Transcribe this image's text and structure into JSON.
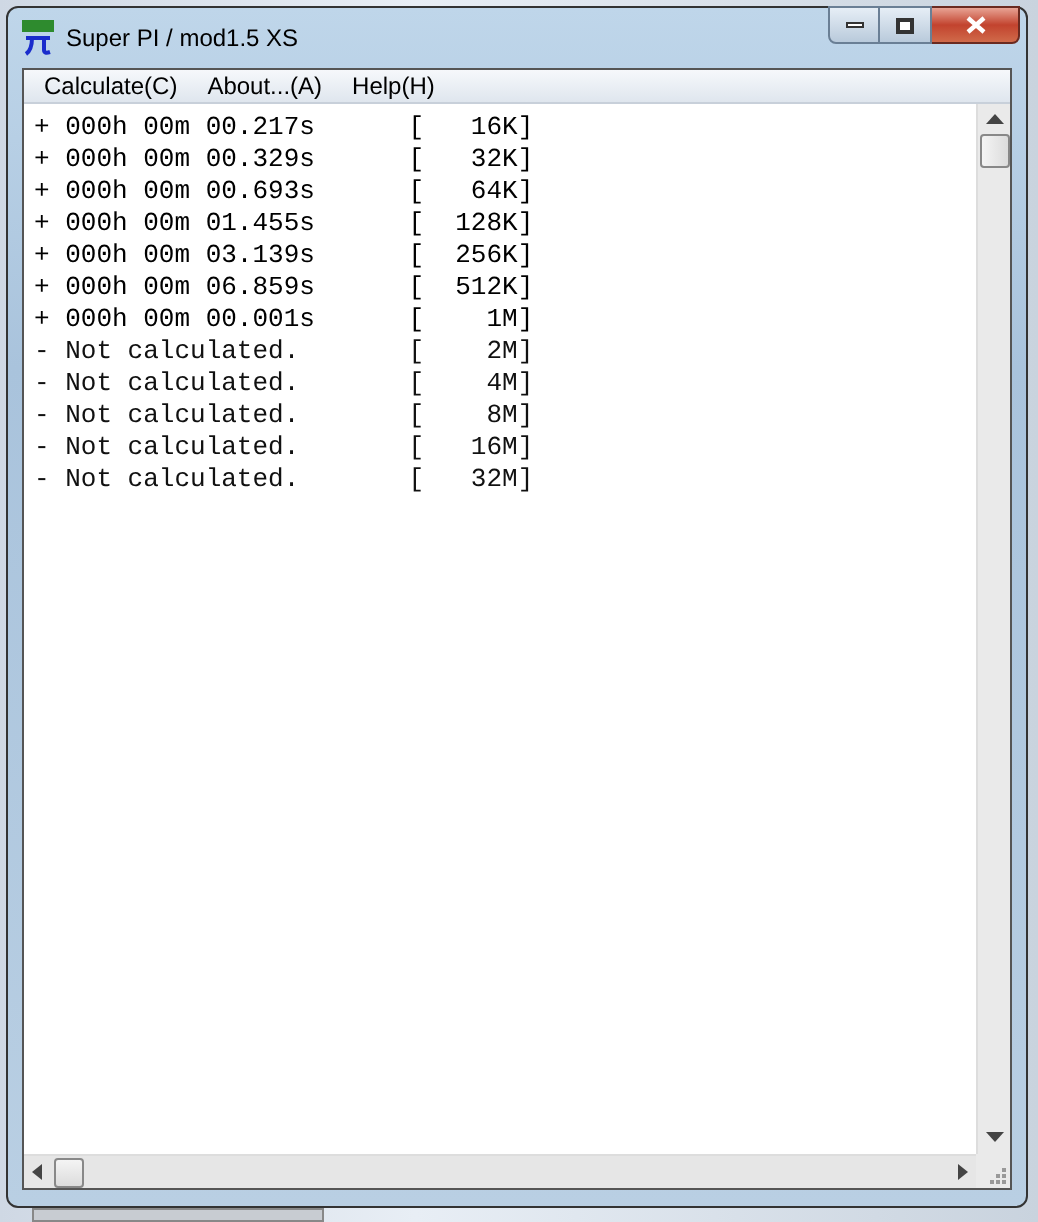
{
  "window": {
    "title": "Super PI / mod1.5 XS"
  },
  "menu": [
    "Calculate(C)",
    "About...(A)",
    "Help(H)"
  ],
  "results": [
    {
      "kind": "done",
      "text": "+ 000h 00m 00.217s      [   16K]"
    },
    {
      "kind": "done",
      "text": "+ 000h 00m 00.329s      [   32K]"
    },
    {
      "kind": "done",
      "text": "+ 000h 00m 00.693s      [   64K]"
    },
    {
      "kind": "done",
      "text": "+ 000h 00m 01.455s      [  128K]"
    },
    {
      "kind": "done",
      "text": "+ 000h 00m 03.139s      [  256K]"
    },
    {
      "kind": "done",
      "text": "+ 000h 00m 06.859s      [  512K]"
    },
    {
      "kind": "done",
      "text": "+ 000h 00m 00.001s      [    1M]"
    },
    {
      "kind": "pending",
      "text": "- Not calculated.       [    2M]"
    },
    {
      "kind": "pending",
      "text": "- Not calculated.       [    4M]"
    },
    {
      "kind": "pending",
      "text": "- Not calculated.       [    8M]"
    },
    {
      "kind": "pending",
      "text": "- Not calculated.       [   16M]"
    },
    {
      "kind": "pending",
      "text": "- Not calculated.       [   32M]"
    }
  ]
}
